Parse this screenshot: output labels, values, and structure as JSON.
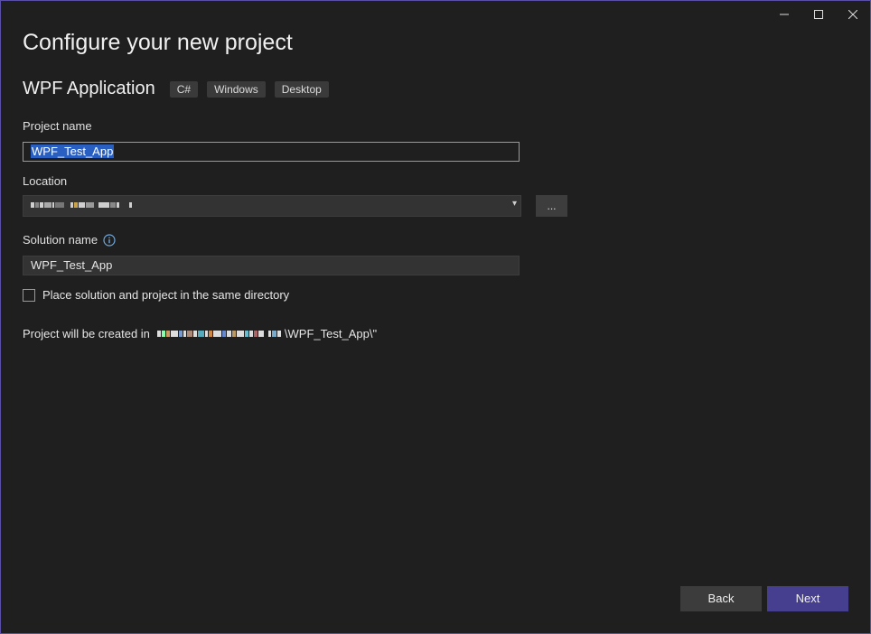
{
  "dialog": {
    "title": "Configure your new project",
    "template_name": "WPF Application",
    "tags": [
      "C#",
      "Windows",
      "Desktop"
    ]
  },
  "fields": {
    "project_name_label": "Project name",
    "project_name_value": "WPF_Test_App",
    "location_label": "Location",
    "browse_label": "...",
    "solution_name_label": "Solution name",
    "solution_name_value": "WPF_Test_App",
    "same_directory_label": "Place solution and project in the same directory",
    "same_directory_checked": false
  },
  "summary": {
    "prefix": "Project will be created in",
    "path_suffix": "\\WPF_Test_App\\\""
  },
  "buttons": {
    "back": "Back",
    "next": "Next"
  },
  "icons": {
    "minimize": "minimize-icon",
    "maximize": "maximize-icon",
    "close": "close-icon",
    "info": "info-icon",
    "dropdown": "chevron-down-icon"
  },
  "colors": {
    "background": "#1f1f1f",
    "accent": "#463f8f",
    "selection": "#2a5fc2",
    "border": "#5a4fa8"
  }
}
